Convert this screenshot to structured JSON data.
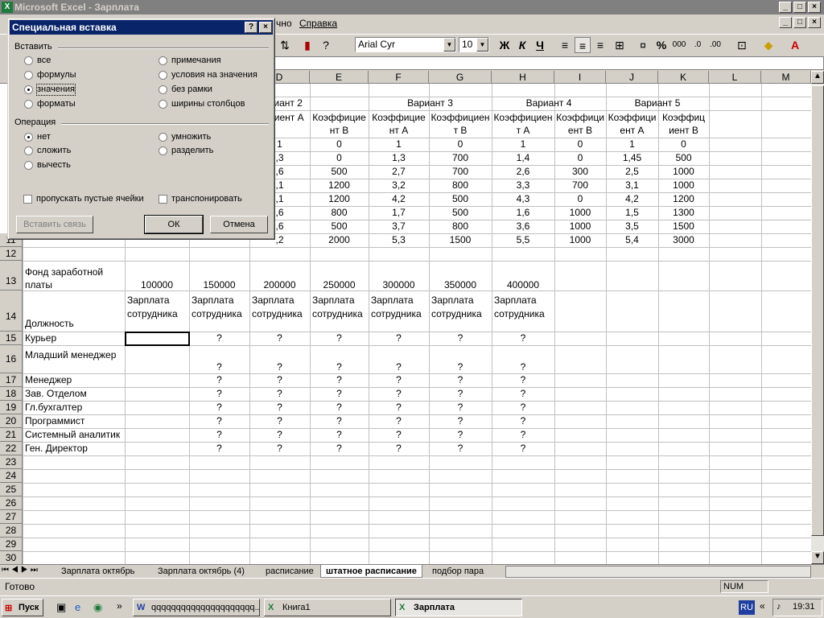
{
  "window": {
    "title": "Microsoft Excel - Зарплата",
    "doc_controls": [
      "_",
      "□",
      "×"
    ]
  },
  "menu": {
    "visible_items": [
      "чно",
      "Справка"
    ]
  },
  "toolbar": {
    "font_name": "Arial Cyr",
    "font_size": "10",
    "bold": "Ж",
    "italic": "К",
    "underline": "Ч",
    "percent": "%",
    "thousands": "000"
  },
  "columns": [
    "D",
    "E",
    "F",
    "G",
    "H",
    "I",
    "J",
    "K",
    "L",
    "M"
  ],
  "rows": {
    "r2": {
      "n": "",
      "d": "Вариант 2",
      "f": "Вариант 3",
      "h": "Вариант 4",
      "j": "Вариант 5"
    },
    "r3": {
      "d": "фициент А",
      "e": "Коэффициент В",
      "f": "Коэффициент А",
      "g": "Коэффициент В",
      "h": "Коэффициент А",
      "i": "Коэффициент В",
      "j": "Коэффициент А",
      "k": "Коэффициент В"
    },
    "data": [
      [
        "1",
        "0",
        "1",
        "0",
        "1",
        "0",
        "1",
        "0"
      ],
      [
        ",3",
        "0",
        "1,3",
        "700",
        "1,4",
        "0",
        "1,45",
        "500"
      ],
      [
        ",6",
        "500",
        "2,7",
        "700",
        "2,6",
        "300",
        "2,5",
        "1000"
      ],
      [
        ",1",
        "1200",
        "3,2",
        "800",
        "3,3",
        "700",
        "3,1",
        "1000"
      ],
      [
        ",1",
        "1200",
        "4,2",
        "500",
        "4,3",
        "0",
        "4,2",
        "1200"
      ],
      [
        ",6",
        "800",
        "1,7",
        "500",
        "1,6",
        "1000",
        "1,5",
        "1300"
      ],
      [
        ",6",
        "500",
        "3,7",
        "800",
        "3,6",
        "1000",
        "3,5",
        "1500"
      ],
      [
        ",2",
        "2000",
        "5,3",
        "1500",
        "5,5",
        "1000",
        "5,4",
        "3000"
      ]
    ],
    "r13": {
      "label": "Фонд заработной платы",
      "values": [
        "100000",
        "150000",
        "200000",
        "250000",
        "300000",
        "350000",
        "400000"
      ]
    },
    "r14": {
      "label": "Должность",
      "header": "Зарплата сотрудника"
    },
    "positions": [
      "Курьер",
      "Младший менеджер",
      "Менеджер",
      "Зав. Отделом",
      "Гл.бухгалтер",
      "Программист",
      "Системный аналитик",
      "Ген. Директор"
    ],
    "placeholder": "?"
  },
  "row_numbers": [
    "11",
    "12",
    "13",
    "14",
    "15",
    "16",
    "17",
    "18",
    "19",
    "20",
    "21",
    "22",
    "23",
    "24",
    "25",
    "26",
    "27",
    "28",
    "29",
    "30"
  ],
  "sheet_tabs": [
    "Зарплата октябрь",
    "Зарплата октябрь (4)",
    "расписание",
    "штатное расписание",
    "подбор пара"
  ],
  "status": {
    "ready": "Готово",
    "num": "NUM"
  },
  "taskbar": {
    "start": "Пуск",
    "items": [
      "qqqqqqqqqqqqqqqqqqqqq...",
      "Книга1",
      "Зарплата"
    ],
    "lang": "RU",
    "time": "19:31",
    "expand": "«"
  },
  "dialog": {
    "title": "Специальная вставка",
    "help": "?",
    "close": "×",
    "paste_group": "Вставить",
    "paste_options": [
      "все",
      "формулы",
      "значения",
      "форматы",
      "примечания",
      "условия на значения",
      "без рамки",
      "ширины столбцов"
    ],
    "paste_selected": "значения",
    "op_group": "Операция",
    "op_options": [
      "нет",
      "сложить",
      "вычесть",
      "умножить",
      "разделить"
    ],
    "op_selected": "нет",
    "skip_blanks": "пропускать пустые ячейки",
    "transpose": "транспонировать",
    "paste_link": "Вставить связь",
    "ok": "ОК",
    "cancel": "Отмена"
  }
}
